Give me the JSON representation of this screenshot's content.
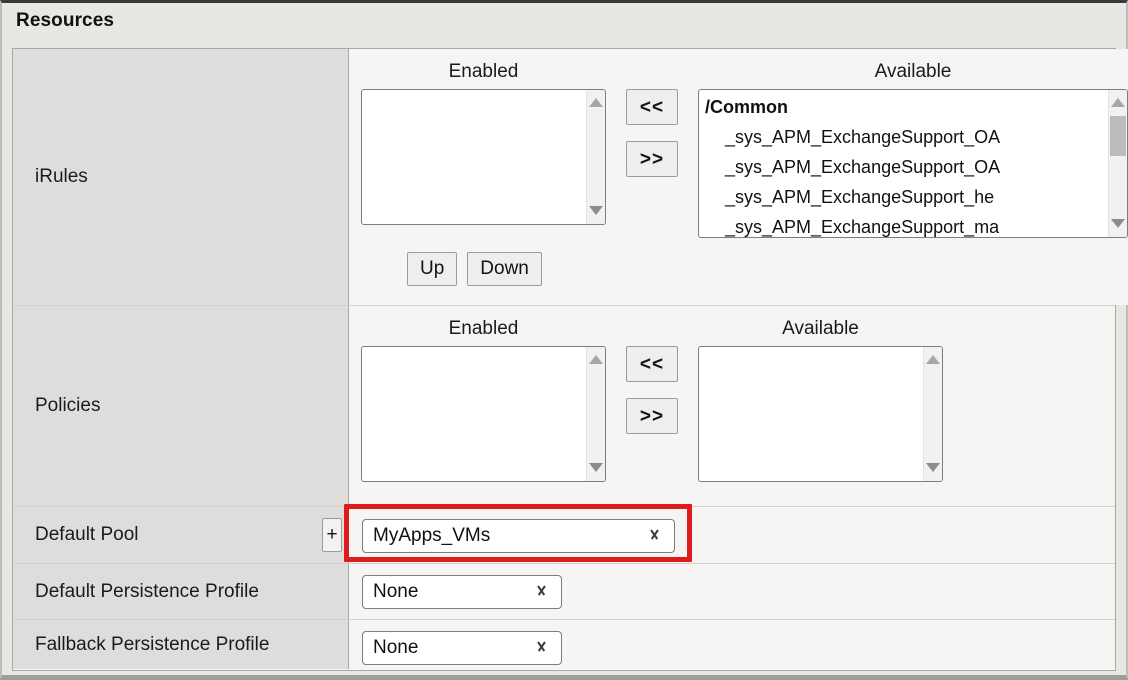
{
  "header": {
    "title": "Resources"
  },
  "rows": {
    "irules": {
      "label": "iRules",
      "enabled_caption": "Enabled",
      "available_caption": "Available",
      "enabled_items": [],
      "available_items": [
        {
          "text": "/Common",
          "type": "group"
        },
        {
          "text": "_sys_APM_ExchangeSupport_OA",
          "type": "child"
        },
        {
          "text": "_sys_APM_ExchangeSupport_OA",
          "type": "child"
        },
        {
          "text": "_sys_APM_ExchangeSupport_he",
          "type": "child"
        },
        {
          "text": "_sys_APM_ExchangeSupport_ma",
          "type": "child"
        }
      ],
      "move_left_label": "<<",
      "move_right_label": ">>",
      "up_label": "Up",
      "down_label": "Down"
    },
    "policies": {
      "label": "Policies",
      "enabled_caption": "Enabled",
      "available_caption": "Available",
      "enabled_items": [],
      "available_items": [],
      "move_left_label": "<<",
      "move_right_label": ">>"
    },
    "default_pool": {
      "label": "Default Pool",
      "plus_label": "+",
      "value": "MyApps_VMs"
    },
    "default_persistence_profile": {
      "label": "Default Persistence Profile",
      "value": "None"
    },
    "fallback_persistence_profile": {
      "label": "Fallback Persistence Profile",
      "value": "None"
    }
  },
  "colors": {
    "highlight": "#e01b1b",
    "label_column_bg": "#dedddb",
    "field_column_bg": "#f6f5f3",
    "header_bg": "#e8e7e3"
  }
}
